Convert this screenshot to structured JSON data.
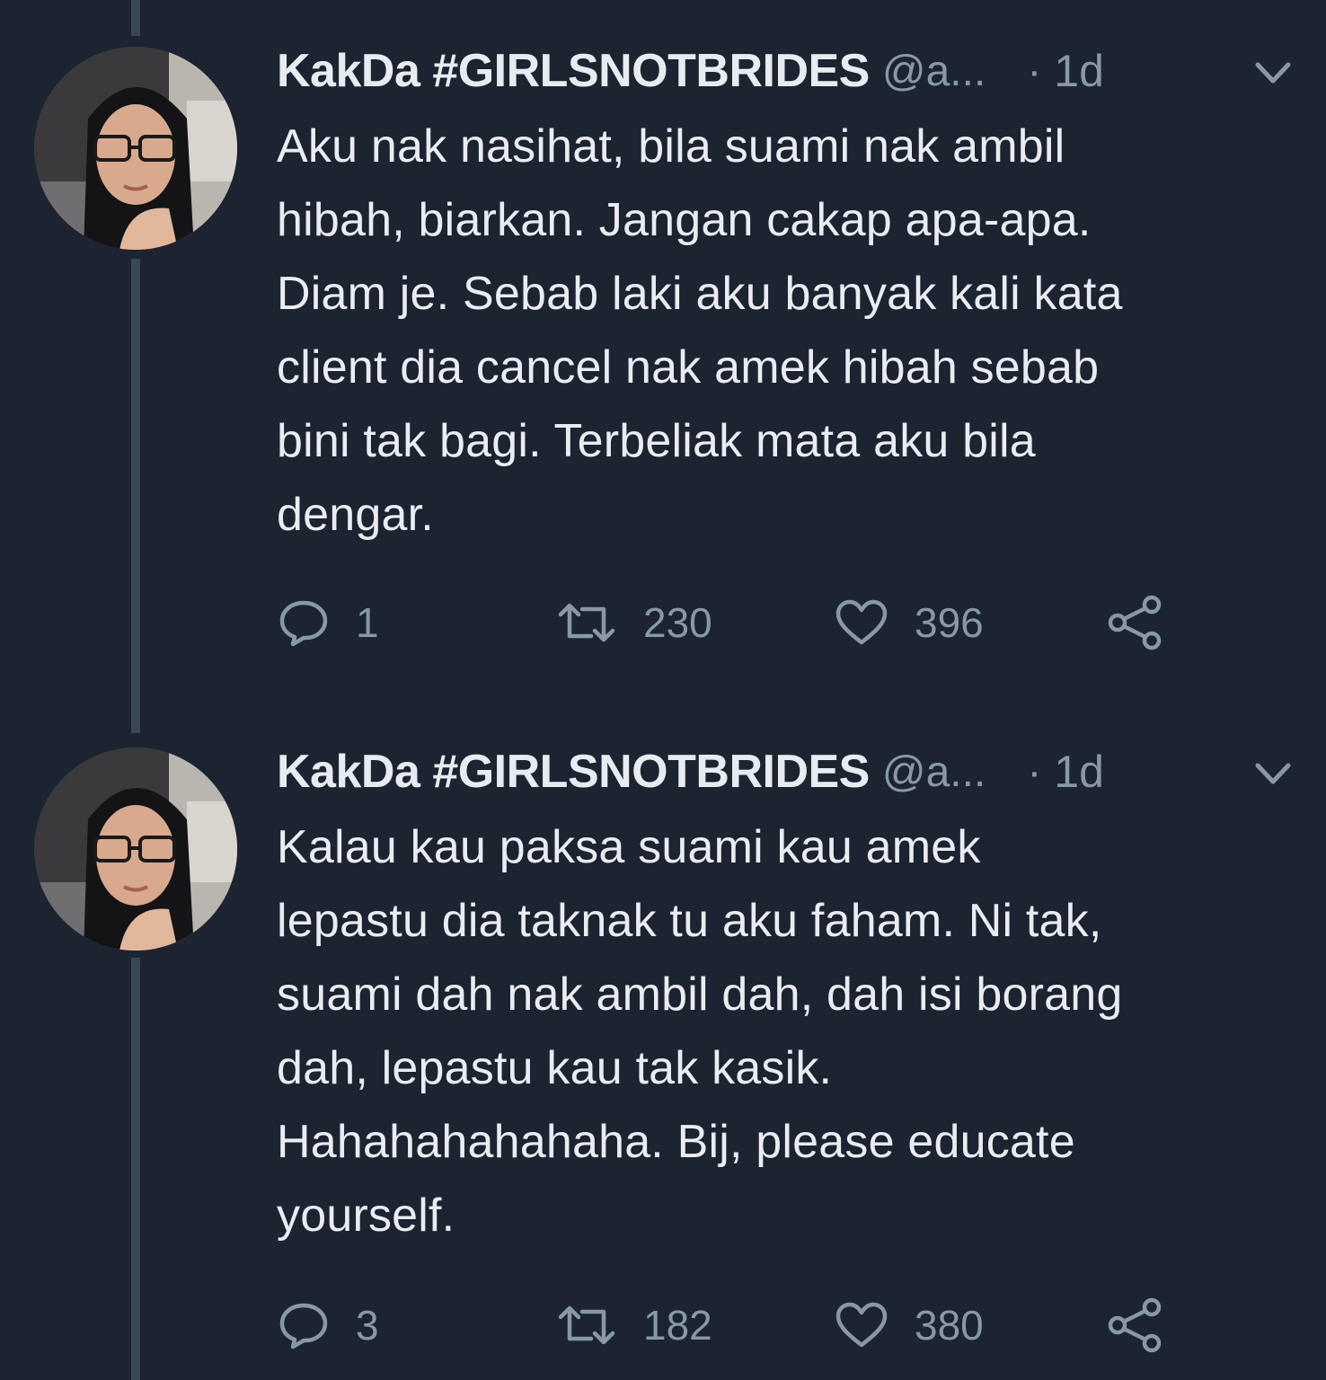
{
  "tweets": [
    {
      "display_name": "KakDa #GIRLSNOTBRIDES",
      "handle": "@a...",
      "separator": "·",
      "time": "1d",
      "text_lines": [
        "Aku nak nasihat, bila suami nak ambil",
        "hibah, biarkan. Jangan cakap apa-apa.",
        "Diam je. Sebab laki aku banyak kali kata",
        "client dia cancel nak amek hibah sebab",
        "bini tak bagi. Terbeliak mata aku bila",
        "dengar."
      ],
      "replies": "1",
      "retweets": "230",
      "likes": "396"
    },
    {
      "display_name": "KakDa #GIRLSNOTBRIDES",
      "handle": "@a...",
      "separator": "·",
      "time": "1d",
      "text_lines": [
        "Kalau kau paksa suami kau amek",
        "lepastu dia taknak tu aku faham. Ni tak,",
        "suami dah nak ambil dah, dah isi borang",
        "dah, lepastu kau tak kasik.",
        "Hahahahahahaha. Bij, please educate",
        "yourself."
      ],
      "replies": "3",
      "retweets": "182",
      "likes": "380"
    }
  ],
  "icons": {
    "reply": "speech-bubble-icon",
    "retweet": "retweet-arrows-icon",
    "like": "heart-icon",
    "share": "share-nodes-icon",
    "menu": "chevron-down-icon"
  },
  "colors": {
    "background": "#1b2430",
    "text": "#e9edf1",
    "secondary": "#8899a6",
    "thread_line": "#3a4756"
  }
}
